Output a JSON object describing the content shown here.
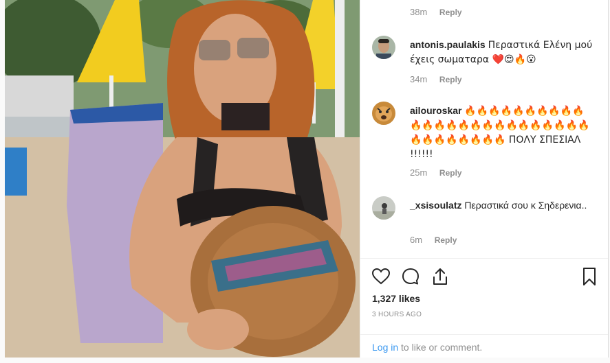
{
  "comments": [
    {
      "time": "38m",
      "reply": "Reply"
    },
    {
      "user": "antonis.paulakis",
      "text": "Περαστικά Ελένη μού έχεις σωματαρα ❤️😍🔥😮",
      "time": "34m",
      "reply": "Reply"
    },
    {
      "user": "ailouroskar",
      "text": "🔥🔥🔥🔥🔥🔥🔥🔥🔥🔥🔥🔥🔥🔥🔥🔥🔥🔥🔥🔥🔥🔥🔥🔥🔥🔥🔥🔥🔥🔥🔥🔥🔥 ΠΟΛΥ ΣΠΕΣΙΑΛ !!!!!!",
      "time": "25m",
      "reply": "Reply"
    },
    {
      "user": "_xsisoulatz",
      "text": "Περαστικά σου κ Σηδερενια..",
      "time": "6m",
      "reply": "Reply"
    }
  ],
  "actions": {
    "like_icon": "heart-icon",
    "comment_icon": "comment-icon",
    "share_icon": "share-icon",
    "save_icon": "bookmark-icon"
  },
  "likes": "1,327 likes",
  "posted": "3 HOURS AGO",
  "login": {
    "link": "Log in",
    "rest": " to like or comment."
  }
}
